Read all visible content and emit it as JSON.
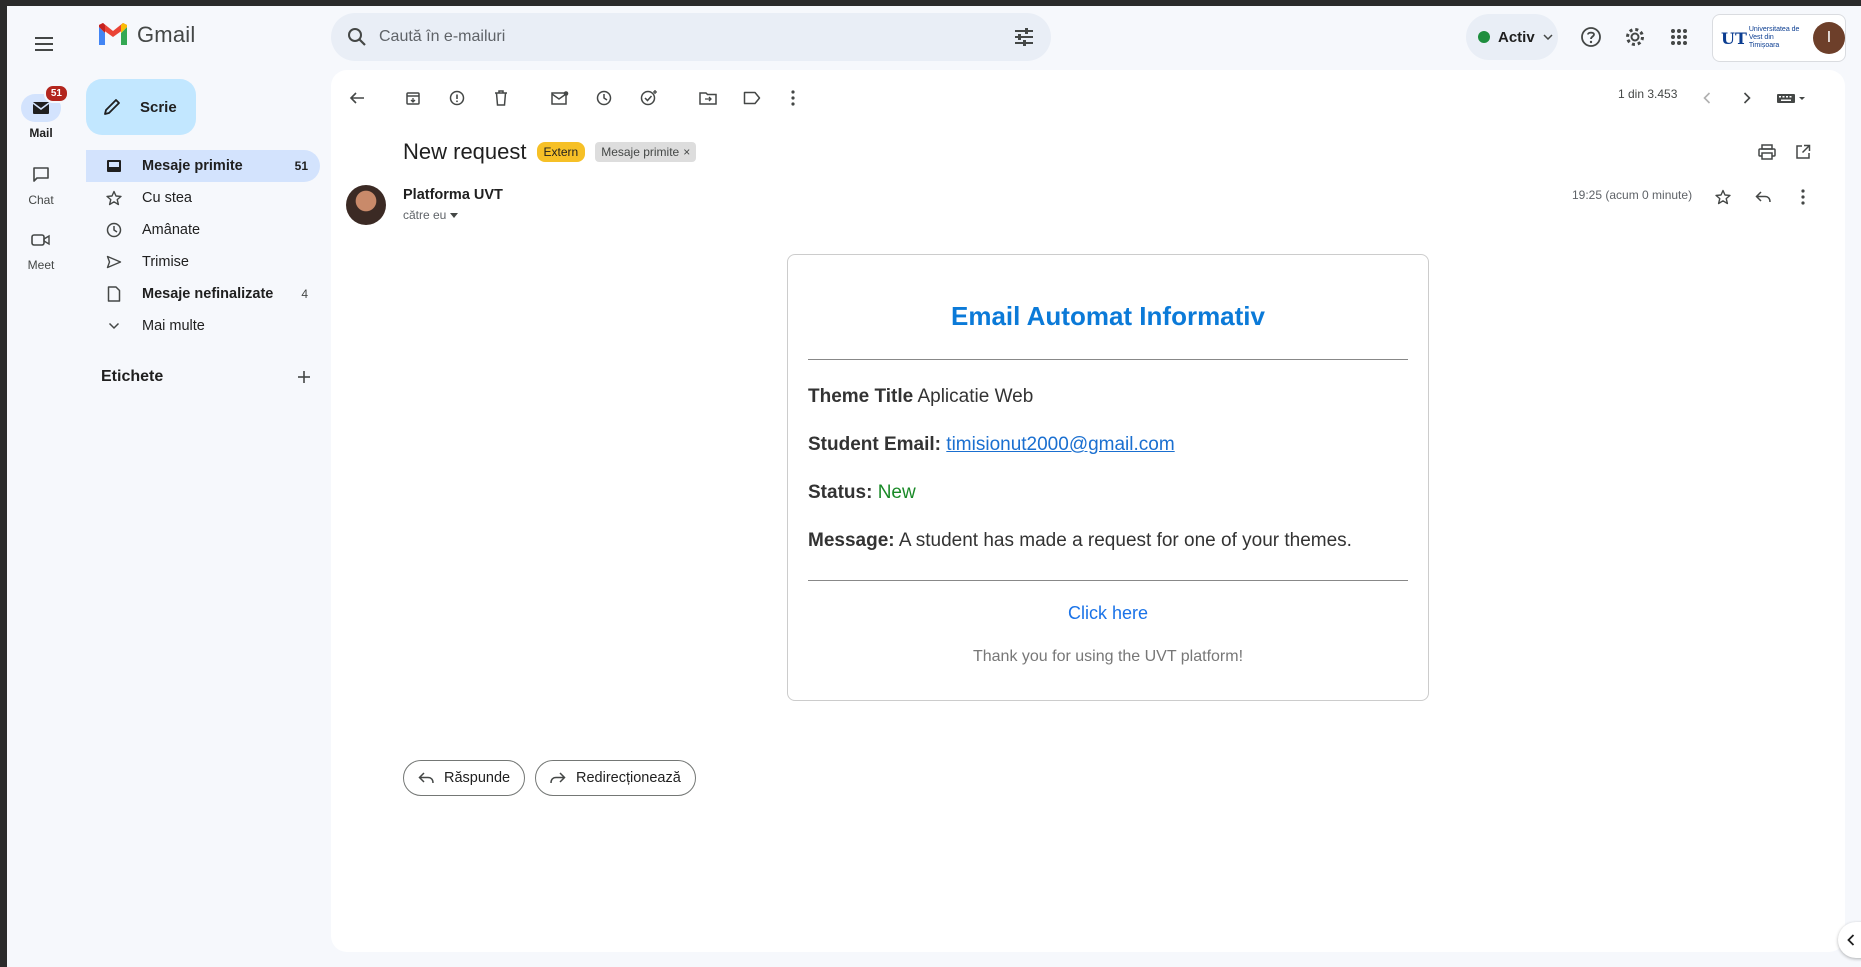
{
  "app": {
    "name": "Gmail"
  },
  "rail": {
    "items": [
      {
        "label": "Mail",
        "badge": "51"
      },
      {
        "label": "Chat"
      },
      {
        "label": "Meet"
      }
    ]
  },
  "search": {
    "placeholder": "Caută în e-mailuri"
  },
  "status": {
    "label": "Activ",
    "color": "#1e8e3e"
  },
  "account": {
    "org_text": "Universitatea de Vest din Timișoara",
    "avatar_letter": "I"
  },
  "sidebar": {
    "compose_label": "Scrie",
    "items": [
      {
        "label": "Mesaje primite",
        "count": "51",
        "icon": "inbox-icon"
      },
      {
        "label": "Cu stea",
        "count": "",
        "icon": "star-icon"
      },
      {
        "label": "Amânate",
        "count": "",
        "icon": "clock-icon"
      },
      {
        "label": "Trimise",
        "count": "",
        "icon": "send-icon"
      },
      {
        "label": "Mesaje nefinalizate",
        "count": "4",
        "icon": "draft-icon"
      },
      {
        "label": "Mai multe",
        "count": "",
        "icon": "chevron-down-icon"
      }
    ],
    "labels_heading": "Etichete"
  },
  "toolbar": {
    "pager": "1 din 3.453"
  },
  "message": {
    "subject": "New request",
    "chip_extern": "Extern",
    "chip_inbox": "Mesaje primite",
    "sender": "Platforma UVT",
    "recipient": "către eu",
    "time": "19:25 (acum 0 minute)"
  },
  "email_body": {
    "title": "Email Automat Informativ",
    "theme_label": "Theme Title",
    "theme_value": "Aplicatie Web",
    "email_label": "Student Email:",
    "email_value": "timisionut2000@gmail.com",
    "status_label": "Status:",
    "status_value": "New",
    "message_label": "Message:",
    "message_value": "A student has made a request for one of your themes.",
    "link_text": "Click here",
    "thanks": "Thank you for using the UVT platform!"
  },
  "actions": {
    "reply": "Răspunde",
    "forward": "Redirecționează"
  },
  "colors": {
    "accent": "#0b57d0",
    "compose_bg": "#c2e7ff",
    "nav_active_bg": "#d3e3fd",
    "extern_chip": "#f6c026",
    "badge": "#b3261e"
  }
}
